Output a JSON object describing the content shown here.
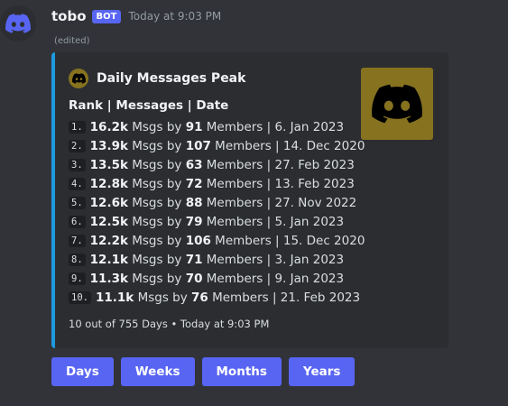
{
  "message": {
    "username": "tobo",
    "bot_badge": "BOT",
    "timestamp": "Today at 9:03 PM",
    "edited": "(edited)"
  },
  "embed": {
    "accent_color": "#1e98e0",
    "author": "Daily Messages Peak",
    "author_icon": "discord-logo-icon",
    "thumbnail_icon": "discord-logo-icon",
    "description_title": "Rank | Messages | Date",
    "rows": [
      {
        "rank": "1.",
        "msgs": "16.2k",
        "members": "91",
        "date": "6. Jan 2023"
      },
      {
        "rank": "2.",
        "msgs": "13.9k",
        "members": "107",
        "date": "14. Dec 2020"
      },
      {
        "rank": "3.",
        "msgs": "13.5k",
        "members": "63",
        "date": "27. Feb 2023"
      },
      {
        "rank": "4.",
        "msgs": "12.8k",
        "members": "72",
        "date": "13. Feb 2023"
      },
      {
        "rank": "5.",
        "msgs": "12.6k",
        "members": "88",
        "date": "27. Nov 2022"
      },
      {
        "rank": "6.",
        "msgs": "12.5k",
        "members": "79",
        "date": "5. Jan 2023"
      },
      {
        "rank": "7.",
        "msgs": "12.2k",
        "members": "106",
        "date": "15. Dec 2020"
      },
      {
        "rank": "8.",
        "msgs": "12.1k",
        "members": "71",
        "date": "3. Jan 2023"
      },
      {
        "rank": "9.",
        "msgs": "11.3k",
        "members": "70",
        "date": "9. Jan 2023"
      },
      {
        "rank": "10.",
        "msgs": "11.1k",
        "members": "76",
        "date": "21. Feb 2023"
      }
    ],
    "row_labels": {
      "msgs_by": "Msgs by",
      "members": "Members |"
    },
    "footer": "10 out of 755 Days • Today at 9:03 PM"
  },
  "buttons": [
    {
      "label": "Days"
    },
    {
      "label": "Weeks"
    },
    {
      "label": "Months"
    },
    {
      "label": "Years"
    }
  ]
}
